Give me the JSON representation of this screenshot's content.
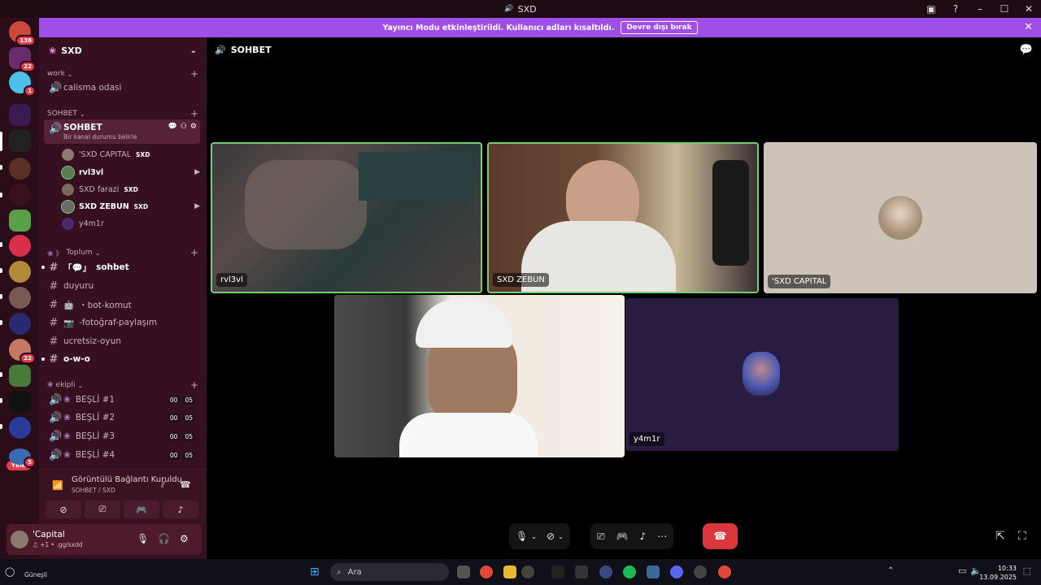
{
  "window": {
    "title": "SXD"
  },
  "banner": {
    "message": "Yayıncı Modu etkinleştirildi. Kullanıcı adları kısaltıldı.",
    "button": "Devre dışı bırak"
  },
  "servers": [
    {
      "badge": "138"
    },
    {
      "badge": "22"
    },
    {
      "badge": "1"
    },
    {
      "badge": ""
    },
    {
      "badge": ""
    },
    {
      "badge": "22"
    },
    {
      "badge": "5"
    }
  ],
  "new_badge": "YENİ",
  "sidebar": {
    "server_name": "SXD",
    "categories": {
      "work": "work",
      "sohbet": "SOHBET",
      "toplum": "Toplum",
      "ekipli": "ekipli"
    },
    "channels": {
      "calisma": "calisma odasi",
      "sohbet_voice": "SOHBET",
      "sohbet_status": "Bir kanal durumu belirle",
      "sohbet_text": "sohbet",
      "duyuru": "duyuru",
      "bot": "・bot-komut",
      "foto": "-fotoğraf-paylaşım",
      "ucretsiz": "ucretsiz-oyun",
      "owo": "o-w-o",
      "besli1": "BEŞLİ #1",
      "besli2": "BEŞLİ #2",
      "besli3": "BEŞLİ #3",
      "besli4": "BEŞLİ #4"
    },
    "voice_counts": {
      "a": "00",
      "b": "05"
    },
    "voice_users": [
      {
        "name": "'SXD CAPITAL",
        "tag": "SXD"
      },
      {
        "name": "rvl3vl",
        "tag": ""
      },
      {
        "name": "SXD farazi",
        "tag": "SXD"
      },
      {
        "name": "SXD ZEBUN",
        "tag": "SXD"
      },
      {
        "name": "y4m1r",
        "tag": ""
      }
    ]
  },
  "voice_panel": {
    "title": "Görüntülü Bağlantı Kuruldu",
    "subtitle": "SOHBET / SXD"
  },
  "user": {
    "name": "'Capital",
    "status": "♫ +1 • .gg/sxdd"
  },
  "main": {
    "channel_title": "SOHBET",
    "tiles": [
      {
        "label": "rvl3vl"
      },
      {
        "label": "SXD ZEBUN"
      },
      {
        "label": "'SXD CAPITAL"
      },
      {
        "label": ""
      },
      {
        "label": "y4m1r"
      }
    ]
  },
  "taskbar": {
    "search_placeholder": "Ara",
    "weather_line2": "Güneşli",
    "time": "10:33",
    "date": "13.09.2025"
  },
  "colors": {
    "banner": "#a04ee8",
    "rail": "#2b0c19",
    "sidebar": "#361020",
    "hangup": "#da373c",
    "speaking_border": "#6fcf73"
  }
}
